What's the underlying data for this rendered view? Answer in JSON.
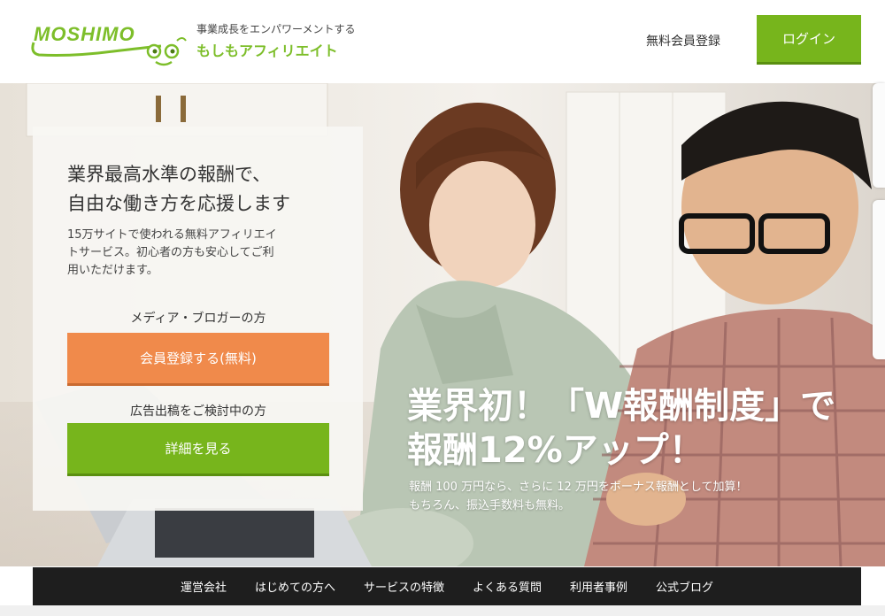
{
  "header": {
    "logo_text": "MOSHIMO",
    "tagline_sub": "事業成長をエンパワーメントする",
    "tagline_main": "もしもアフィリエイト",
    "signup_link": "無料会員登録",
    "login_button": "ログイン"
  },
  "panel": {
    "headline_line1": "業界最高水準の報酬で、",
    "headline_line2": "自由な働き方を応援します",
    "desc_line1": "15万サイトで使われる無料アフィリエイ",
    "desc_line2": "トサービス。初心者の方も安心してご利",
    "desc_line3": "用いただけます。",
    "media_label": "メディア・ブロガーの方",
    "register_button": "会員登録する(無料)",
    "ads_label": "広告出稿をご検討中の方",
    "details_button": "詳細を見る"
  },
  "promo": {
    "line1": "業界初！「W報酬制度」で",
    "line2": "報酬12%アップ！",
    "sub_line1": "報酬 100 万円なら、さらに 12 万円をボーナス報酬として加算！",
    "sub_line2": "もちろん、振込手数料も無料。"
  },
  "nav": {
    "items": [
      "運営会社",
      "はじめての方へ",
      "サービスの特徴",
      "よくある質問",
      "利用者事例",
      "公式ブログ"
    ]
  },
  "colors": {
    "brand_green": "#77b51c",
    "accent_orange": "#f08a4b",
    "nav_bg": "#1e1e1e"
  }
}
